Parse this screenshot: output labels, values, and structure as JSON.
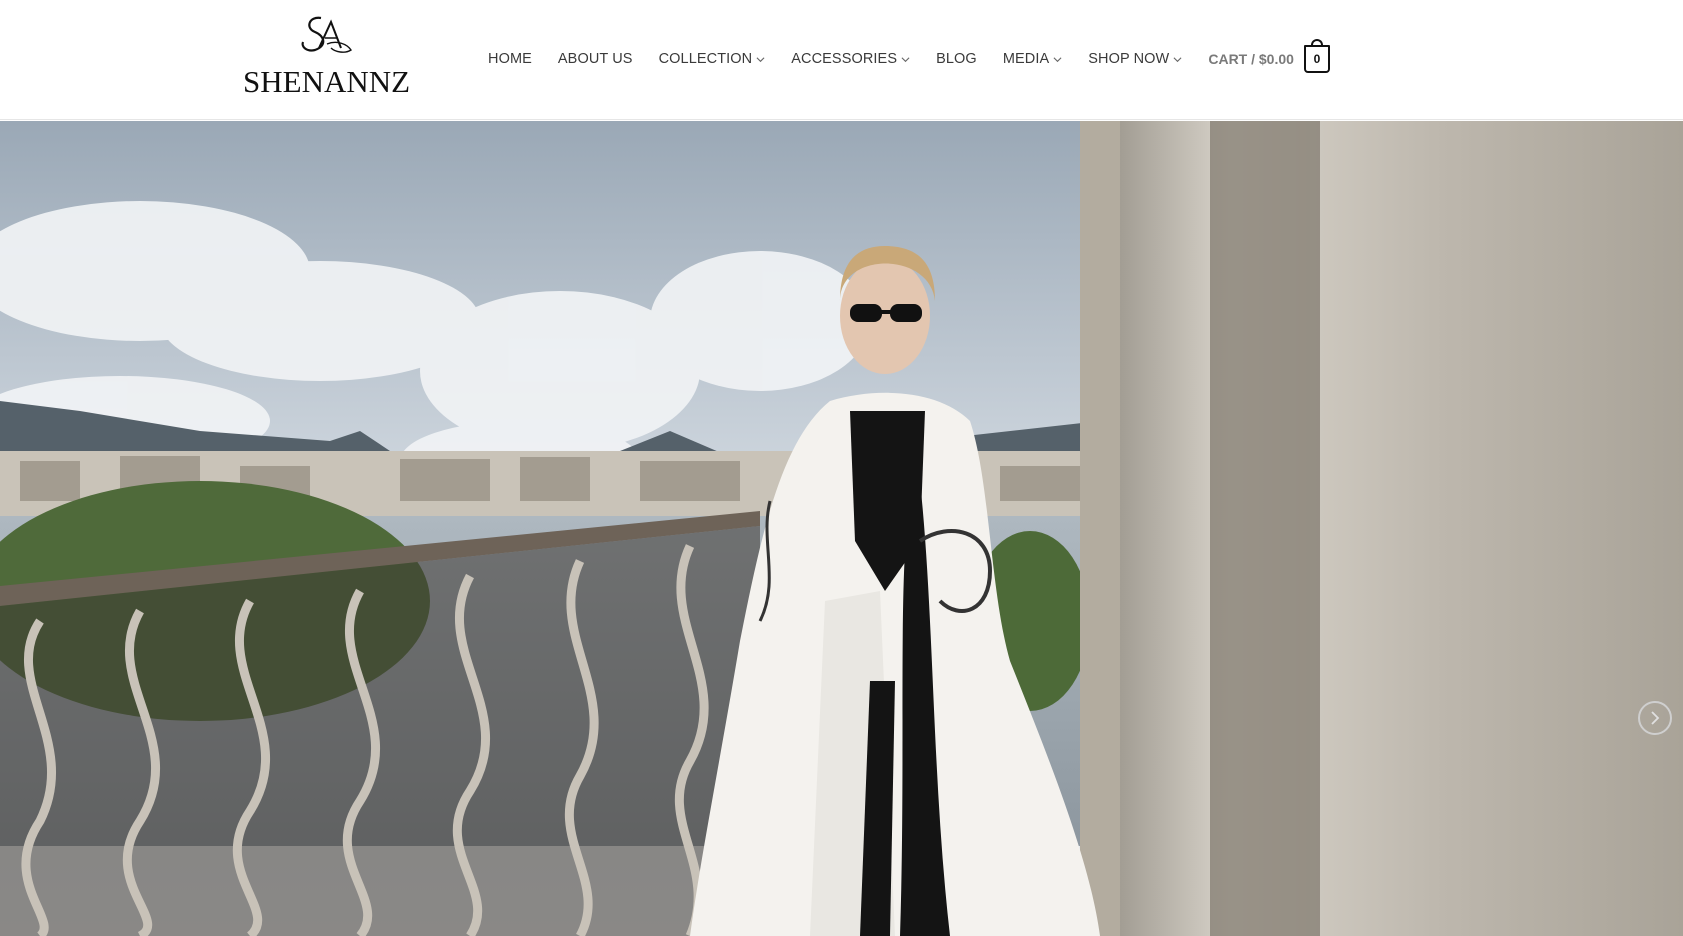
{
  "brand": {
    "monogram": "SA",
    "wordmark": "SHENANNZ"
  },
  "nav": {
    "items": [
      {
        "label": "HOME",
        "has_dropdown": false
      },
      {
        "label": "ABOUT US",
        "has_dropdown": false
      },
      {
        "label": "COLLECTION",
        "has_dropdown": true
      },
      {
        "label": "ACCESSORIES",
        "has_dropdown": true
      },
      {
        "label": "BLOG",
        "has_dropdown": false
      },
      {
        "label": "MEDIA",
        "has_dropdown": true
      },
      {
        "label": "SHOP NOW",
        "has_dropdown": true
      }
    ],
    "cart_label": "CART / $0.00",
    "cart_count": "0"
  },
  "hero": {
    "icons": {
      "next": "chevron-right-icon"
    }
  },
  "colors": {
    "nav_text": "#3a3a3a",
    "cart_text": "#7a7a7a",
    "sky": "#c8d2dc",
    "column": "#d9d4cc"
  }
}
